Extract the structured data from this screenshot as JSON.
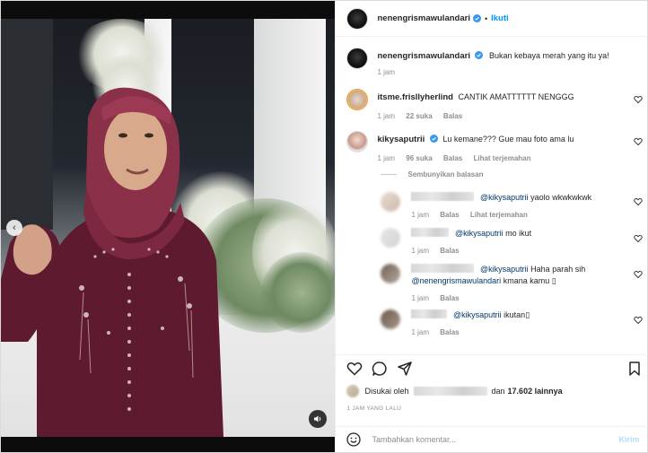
{
  "header": {
    "username": "nenengrismawulandari",
    "separator": "•",
    "follow_label": "Ikuti"
  },
  "caption": {
    "username": "nenengrismawulandari",
    "text": "Bukan kebaya merah yang itu ya!",
    "time": "1 jam"
  },
  "comments": [
    {
      "username": "itsme.frisllyherlind",
      "text": "CANTIK AMATTTTTT NENGGG",
      "time": "1 jam",
      "likes": "22 suka",
      "reply_label": "Balas"
    },
    {
      "username": "kikysaputrii",
      "text": "Lu kemane??? Gue mau foto ama lu",
      "time": "1 jam",
      "likes": "96 suka",
      "reply_label": "Balas",
      "translate_label": "Lihat terjemahan"
    }
  ],
  "hide_replies_label": "Sembunyikan balasan",
  "replies": [
    {
      "mention": "@kikysaputrii",
      "text": "yaolo wkwkwkwk",
      "time": "1 jam",
      "reply_label": "Balas",
      "translate_label": "Lihat terjemahan"
    },
    {
      "mention": "@kikysaputrii",
      "text": "mo ikut",
      "time": "1 jam",
      "reply_label": "Balas"
    },
    {
      "mention": "@kikysaputrii",
      "text": "Haha parah sih",
      "mention2": "@nenengrismawulandari",
      "text2": "kmana kamu ▯",
      "time": "1 jam",
      "reply_label": "Balas"
    },
    {
      "mention": "@kikysaputrii",
      "text": "ikutan▯",
      "time": "1 jam",
      "reply_label": "Balas"
    }
  ],
  "likes": {
    "prefix": "Disukai oleh",
    "conj": "dan",
    "count": "17.602 lainnya"
  },
  "timestamp": "1 JAM YANG LALU",
  "add_comment": {
    "placeholder": "Tambahkan komentar...",
    "post_label": "Kirim"
  },
  "colors": {
    "accent": "#0095f6",
    "verified": "#3897f0",
    "kebaya": "#6b1f35",
    "hijab": "#8a3048"
  },
  "icons": [
    "chevron-left-icon",
    "speaker-icon",
    "verified-badge-icon",
    "heart-icon",
    "comment-icon",
    "share-icon",
    "bookmark-icon",
    "emoji-icon"
  ]
}
